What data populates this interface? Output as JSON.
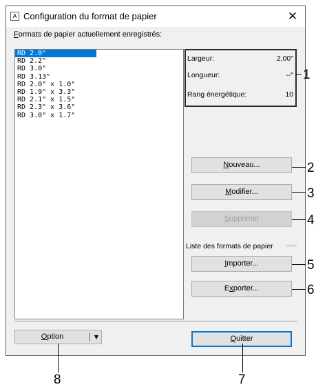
{
  "window": {
    "title": "Configuration du format de papier",
    "icon_glyph": "A",
    "close_glyph": "✕"
  },
  "formats": {
    "caption_accesskey": "F",
    "caption_rest": "ormats de papier actuellement enregistrés:",
    "items": [
      "RD 2.0\"",
      "RD 2.2\"",
      "RD 3.0\"",
      "RD 3.13\"",
      "RD 2.0\" x 1.0\"",
      "RD 1.9\" x 3.3\"",
      "RD 2.1\" x 1.5\"",
      "RD 2.3\" x 3.6\"",
      "RD 3.0\" x 1.7\""
    ],
    "selected_index": 0
  },
  "info": {
    "width_label": "Largeur:",
    "width_value": "2,00\"",
    "length_label": "Longueur:",
    "length_value": "--\"",
    "energy_label": "Rang énergétique:",
    "energy_value": "10"
  },
  "buttons": {
    "new_key": "N",
    "new_rest": "ouveau...",
    "modify_key": "M",
    "modify_rest": "odifier...",
    "delete_key": "S",
    "delete_rest": "upprimer",
    "import_pre": "",
    "import_key": "I",
    "import_rest": "mporter...",
    "export_pre": "E",
    "export_key": "x",
    "export_rest": "porter...",
    "quit_pre": "",
    "quit_key": "Q",
    "quit_rest": "uitter",
    "option_key": "O",
    "option_rest": "ption",
    "option_arrow": "▼"
  },
  "paper_list_group": {
    "label": "Liste des formats de papier"
  },
  "callouts": {
    "c1": "1",
    "c2": "2",
    "c3": "3",
    "c4": "4",
    "c5": "5",
    "c6": "6",
    "c7": "7",
    "c8": "8"
  },
  "colors": {
    "selection": "#0078d7",
    "dialog_bg": "#f0f0f0",
    "default_button_border": "#0078d7"
  }
}
